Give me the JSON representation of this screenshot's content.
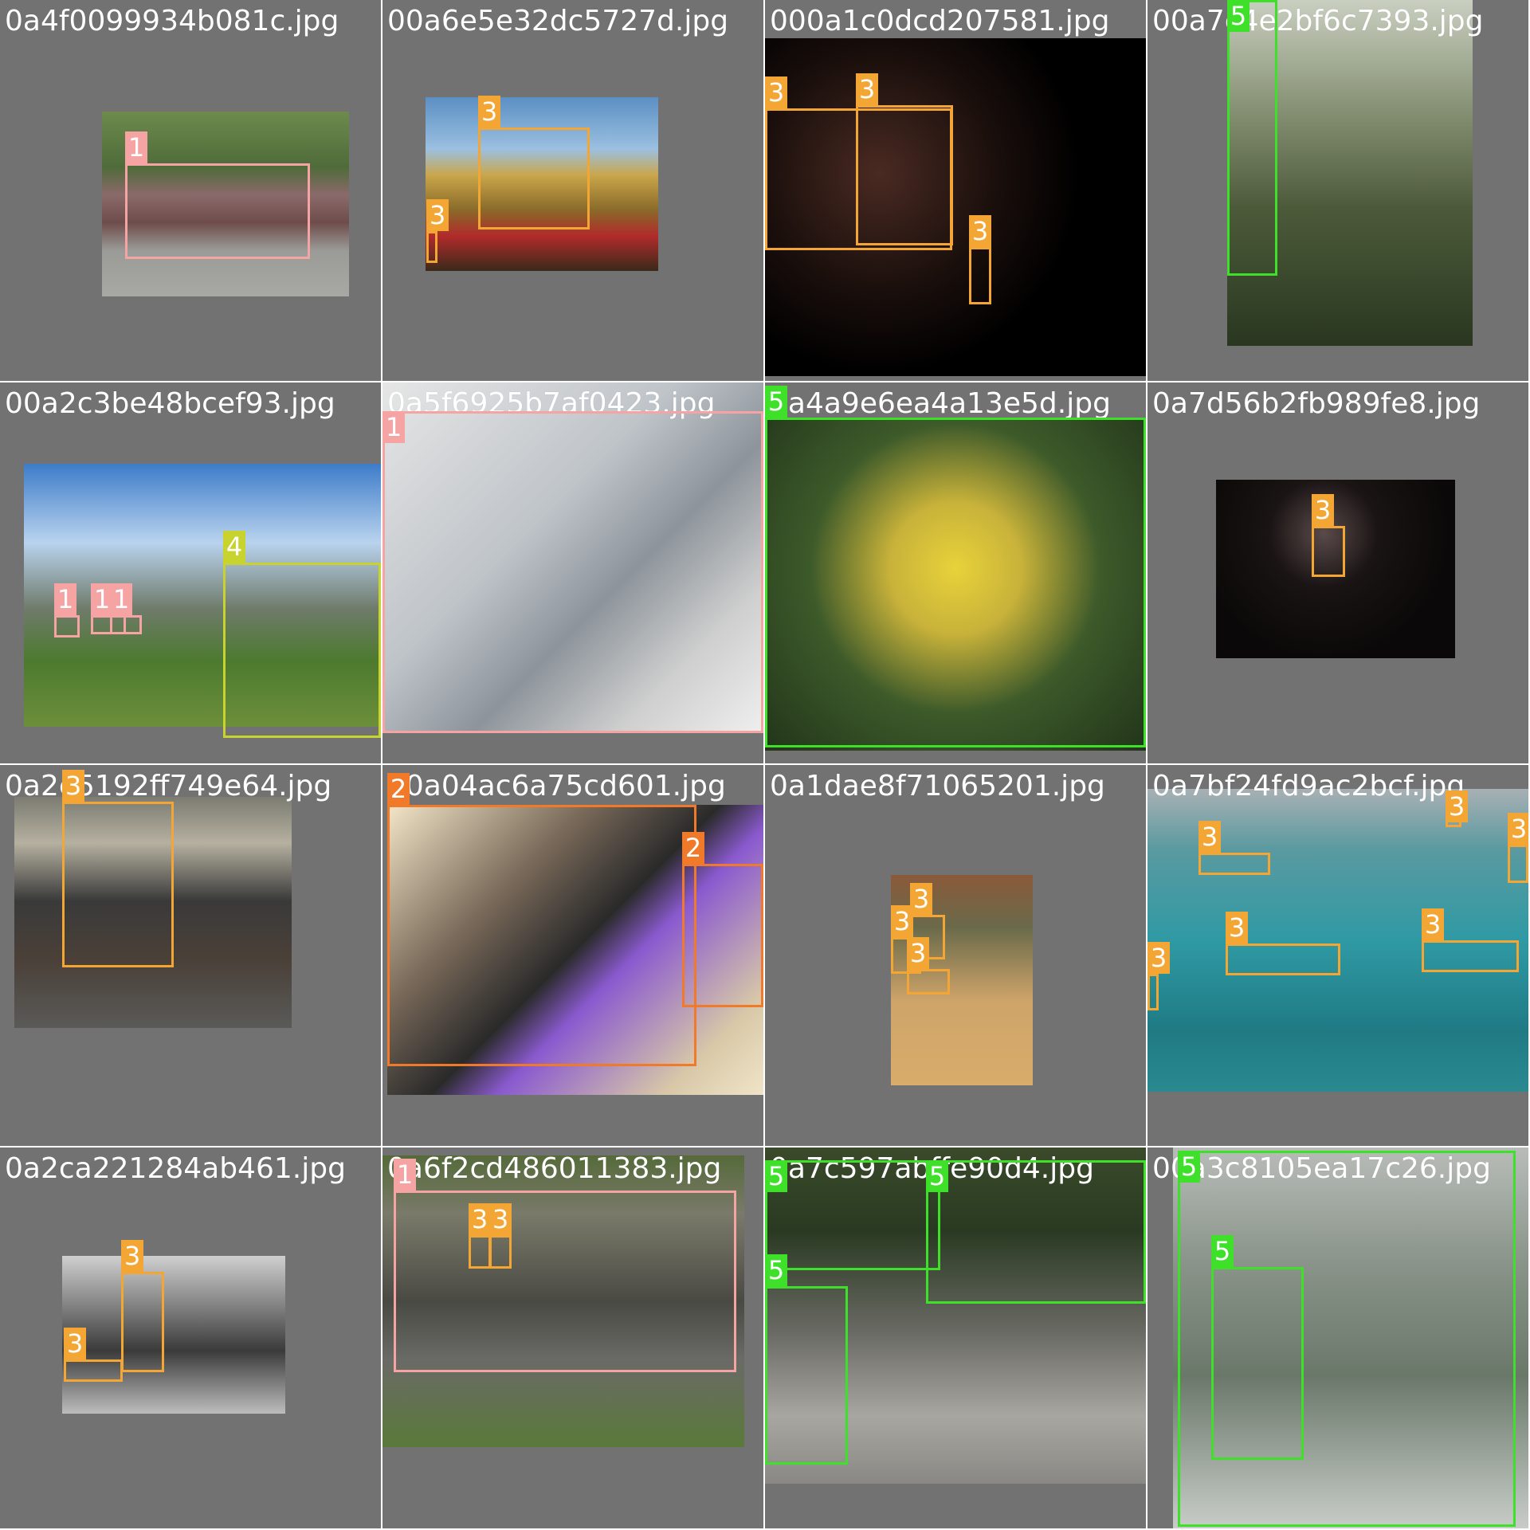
{
  "title": "",
  "classes": {
    "1": {
      "color": "#f5a3a3"
    },
    "2": {
      "color": "#f07a2a"
    },
    "3": {
      "color": "#f4a634"
    },
    "4": {
      "color": "#c9d32e"
    },
    "5": {
      "color": "#3fe02a"
    }
  },
  "tiles": [
    {
      "filename": "0a4f0099934b081c.jpg",
      "labels": [
        "1"
      ]
    },
    {
      "filename": "00a6e5e32dc5727d.jpg",
      "labels": [
        "3",
        "3"
      ]
    },
    {
      "filename": "000a1c0dcd207581.jpg",
      "labels": [
        "3",
        "3",
        "3"
      ]
    },
    {
      "filename": "00a7c4e2bf6c7393.jpg",
      "labels": [
        "5"
      ]
    },
    {
      "filename": "00a2c3be48bcef93.jpg",
      "labels": [
        "4",
        "1",
        "1",
        "1"
      ]
    },
    {
      "filename": "0a5f6925b7af0423.jpg",
      "labels": [
        "1"
      ]
    },
    {
      "filename": "0a4a9e6ea4a13e5d.jpg",
      "labels": [
        "5"
      ]
    },
    {
      "filename": "0a7d56b2fb989fe8.jpg",
      "labels": [
        "3"
      ]
    },
    {
      "filename": "0a2e5192ff749e64.jpg",
      "labels": [
        "3"
      ]
    },
    {
      "filename": "00a04ac6a75cd601.jpg",
      "labels": [
        "2",
        "2"
      ]
    },
    {
      "filename": "0a1dae8f71065201.jpg",
      "labels": [
        "3",
        "3",
        "3"
      ]
    },
    {
      "filename": "0a7bf24fd9ac2bcf.jpg",
      "labels": [
        "3",
        "3",
        "3",
        "3",
        "3",
        "3"
      ]
    },
    {
      "filename": "0a2ca221284ab461.jpg",
      "labels": [
        "3",
        "3"
      ]
    },
    {
      "filename": "0a6f2cd486011383.jpg",
      "labels": [
        "1",
        "3",
        "3"
      ]
    },
    {
      "filename": "0a7c597abffe90d4.jpg",
      "labels": [
        "5",
        "5",
        "5"
      ]
    },
    {
      "filename": "00a3c8105ea17c26.jpg",
      "labels": [
        "5",
        "5"
      ]
    }
  ]
}
